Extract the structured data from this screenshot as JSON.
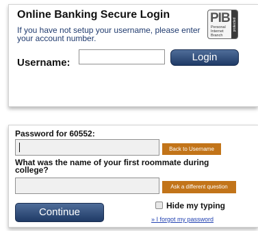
{
  "login_panel": {
    "title": "Online Banking Secure Login",
    "subtitle": "If you have not setup your username, please enter your account number.",
    "username_label": "Username:",
    "username_value": "",
    "login_button": "Login",
    "logo": {
      "letters": "PIB",
      "line1": "Personal",
      "line2": "Internet",
      "line3": "Branch",
      "side_text": "protected"
    }
  },
  "password_panel": {
    "password_label": "Password for 60552:",
    "password_value": "",
    "back_button": "Back to Username",
    "security_question": "What was the name of your first roommate during college?",
    "answer_value": "",
    "ask_different_button": "Ask a different question",
    "continue_button": "Continue",
    "hide_typing_label": "Hide my typing",
    "hide_typing_checked": false,
    "forgot_link": "» I forgot my password"
  },
  "colors": {
    "button_blue": "#1f3a66",
    "button_orange": "#c27419",
    "link_blue": "#1f3fb0",
    "subtitle_blue": "#1f3a6e"
  }
}
